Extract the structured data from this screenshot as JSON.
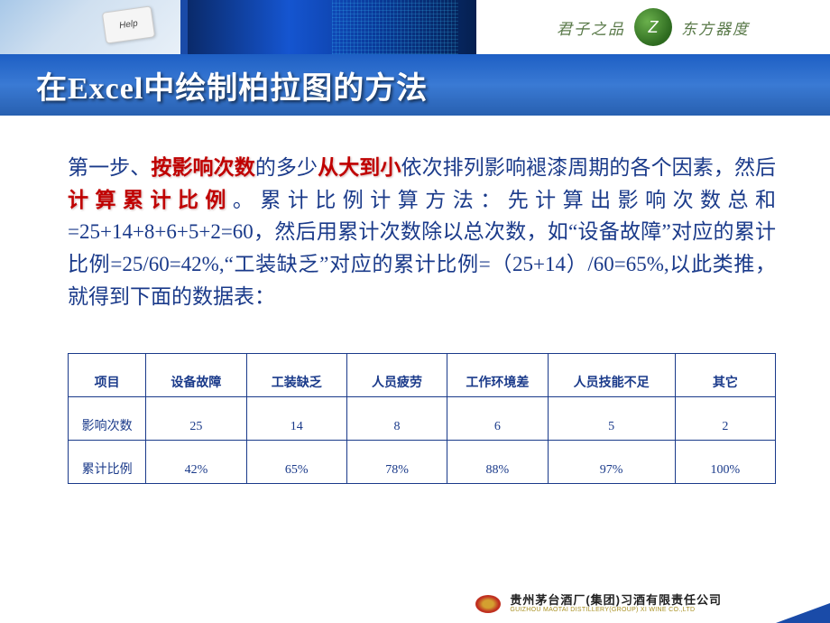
{
  "header": {
    "keyboard_key": "Help",
    "logo_left": "君子之品",
    "logo_right": "东方器度",
    "logo_mark": "Z"
  },
  "title": "在Excel中绘制柏拉图的方法",
  "body": {
    "p1_a": "第一步、",
    "p1_hl1": "按影响次数",
    "p1_b": "的多少",
    "p1_hl2": "从大到小",
    "p1_c": "依次排列影响褪漆周期的各个因素，然后",
    "p1_hl3": "计算累计比例",
    "p1_d": "。累计比例计算方法：先计算出影响次数总和=25+14+8+6+5+2=60，然后用累计次数除以总次数，如“设备故障”对应的累计比例=25/60=42%,“工装缺乏”对应的累计比例=（25+14）/60=65%,以此类推，就得到下面的数据表："
  },
  "table": {
    "headers": [
      "项目",
      "设备故障",
      "工装缺乏",
      "人员疲劳",
      "工作环境差",
      "人员技能不足",
      "其它"
    ],
    "rows": [
      {
        "label": "影响次数",
        "cells": [
          "25",
          "14",
          "8",
          "6",
          "5",
          "2"
        ]
      },
      {
        "label": "累计比例",
        "cells": [
          "42%",
          "65%",
          "78%",
          "88%",
          "97%",
          "100%"
        ]
      }
    ]
  },
  "footer": {
    "company_cn": "贵州茅台酒厂(集团)习酒有限责任公司",
    "company_en": "GUIZHOU MAOTAI DISTILLERY(GROUP) XI WINE CO.,LTD"
  },
  "chart_data": {
    "type": "table",
    "title": "影响褪漆周期因素 Pareto 数据",
    "columns": [
      "项目",
      "影响次数",
      "累计比例"
    ],
    "rows": [
      [
        "设备故障",
        25,
        "42%"
      ],
      [
        "工装缺乏",
        14,
        "65%"
      ],
      [
        "人员疲劳",
        8,
        "78%"
      ],
      [
        "工作环境差",
        6,
        "88%"
      ],
      [
        "人员技能不足",
        5,
        "97%"
      ],
      [
        "其它",
        2,
        "100%"
      ]
    ],
    "total_count": 60
  }
}
